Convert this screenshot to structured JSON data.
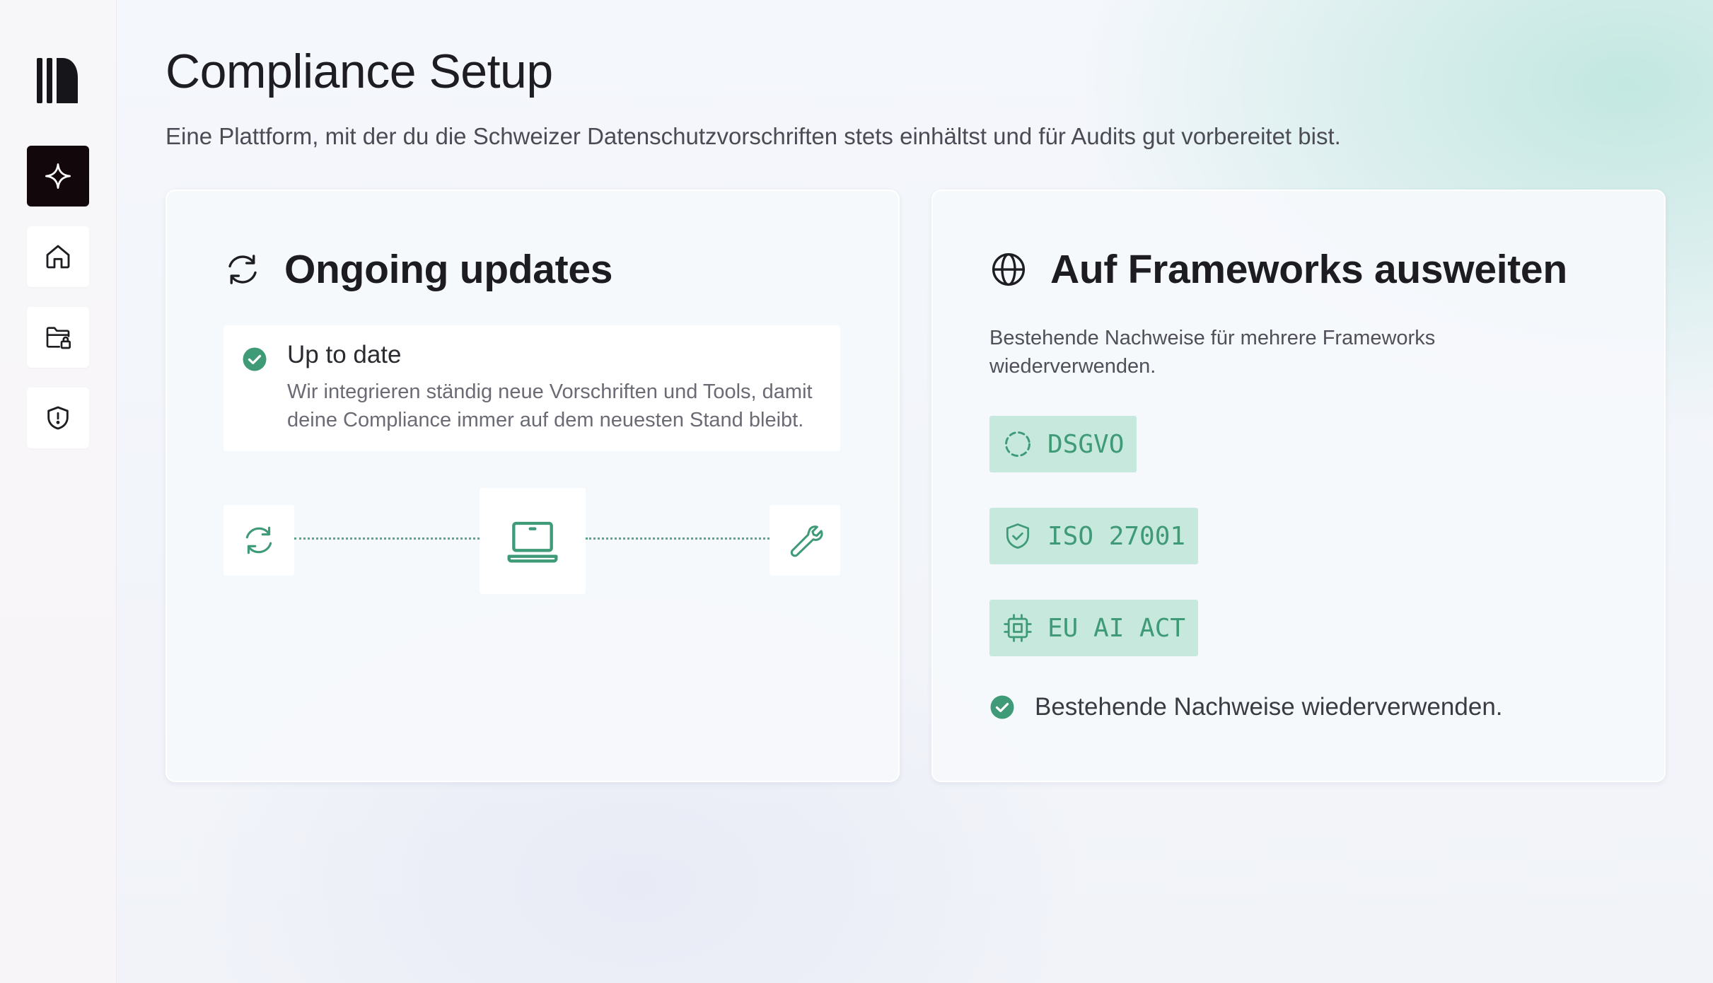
{
  "header": {
    "title": "Compliance Setup",
    "subtitle": "Eine Plattform, mit der du die Schweizer Datenschutzvorschriften stets einhältst und für Audits gut vorbereitet bist."
  },
  "sidebar": {
    "items": [
      {
        "name": "sparkle",
        "icon": "sparkle-icon",
        "active": true
      },
      {
        "name": "home",
        "icon": "home-icon",
        "active": false
      },
      {
        "name": "locked-folder",
        "icon": "folder-lock-icon",
        "active": false
      },
      {
        "name": "shield",
        "icon": "shield-alert-icon",
        "active": false
      }
    ]
  },
  "updates_card": {
    "title": "Ongoing updates",
    "icon": "refresh-icon",
    "status": {
      "title": "Up to date",
      "description": "Wir integrieren ständig neue Vorschriften und Tools, damit deine Compliance immer auf dem neuesten Stand bleibt."
    },
    "flow": [
      "refresh-icon",
      "laptop-icon",
      "wrench-icon"
    ]
  },
  "frameworks_card": {
    "title": "Auf Frameworks ausweiten",
    "icon": "globe-icon",
    "description": "Bestehende Nachweise für mehrere Frameworks wiederverwenden.",
    "tags": [
      {
        "label": "DSGVO",
        "icon": "dashed-circle-icon"
      },
      {
        "label": "ISO 27001",
        "icon": "shield-check-icon"
      },
      {
        "label": "EU AI ACT",
        "icon": "chip-icon"
      }
    ],
    "check_text": "Bestehende Nachweise wiederverwenden."
  },
  "colors": {
    "accent": "#3f9a78",
    "tag_bg": "#c7e9dd",
    "active_nav": "#12080c"
  }
}
